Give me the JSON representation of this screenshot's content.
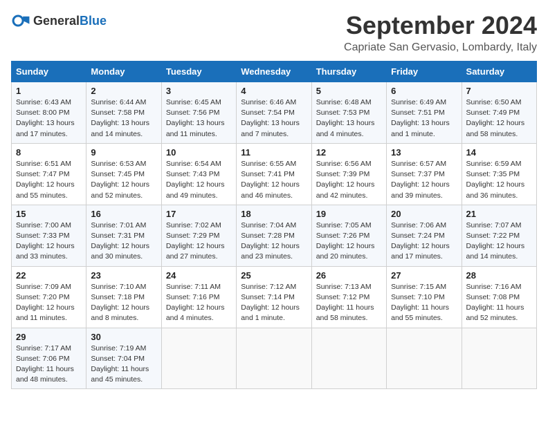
{
  "header": {
    "logo_general": "General",
    "logo_blue": "Blue",
    "month_title": "September 2024",
    "location": "Capriate San Gervasio, Lombardy, Italy"
  },
  "columns": [
    "Sunday",
    "Monday",
    "Tuesday",
    "Wednesday",
    "Thursday",
    "Friday",
    "Saturday"
  ],
  "weeks": [
    [
      {
        "day": "1",
        "lines": [
          "Sunrise: 6:43 AM",
          "Sunset: 8:00 PM",
          "Daylight: 13 hours",
          "and 17 minutes."
        ]
      },
      {
        "day": "2",
        "lines": [
          "Sunrise: 6:44 AM",
          "Sunset: 7:58 PM",
          "Daylight: 13 hours",
          "and 14 minutes."
        ]
      },
      {
        "day": "3",
        "lines": [
          "Sunrise: 6:45 AM",
          "Sunset: 7:56 PM",
          "Daylight: 13 hours",
          "and 11 minutes."
        ]
      },
      {
        "day": "4",
        "lines": [
          "Sunrise: 6:46 AM",
          "Sunset: 7:54 PM",
          "Daylight: 13 hours",
          "and 7 minutes."
        ]
      },
      {
        "day": "5",
        "lines": [
          "Sunrise: 6:48 AM",
          "Sunset: 7:53 PM",
          "Daylight: 13 hours",
          "and 4 minutes."
        ]
      },
      {
        "day": "6",
        "lines": [
          "Sunrise: 6:49 AM",
          "Sunset: 7:51 PM",
          "Daylight: 13 hours",
          "and 1 minute."
        ]
      },
      {
        "day": "7",
        "lines": [
          "Sunrise: 6:50 AM",
          "Sunset: 7:49 PM",
          "Daylight: 12 hours",
          "and 58 minutes."
        ]
      }
    ],
    [
      {
        "day": "8",
        "lines": [
          "Sunrise: 6:51 AM",
          "Sunset: 7:47 PM",
          "Daylight: 12 hours",
          "and 55 minutes."
        ]
      },
      {
        "day": "9",
        "lines": [
          "Sunrise: 6:53 AM",
          "Sunset: 7:45 PM",
          "Daylight: 12 hours",
          "and 52 minutes."
        ]
      },
      {
        "day": "10",
        "lines": [
          "Sunrise: 6:54 AM",
          "Sunset: 7:43 PM",
          "Daylight: 12 hours",
          "and 49 minutes."
        ]
      },
      {
        "day": "11",
        "lines": [
          "Sunrise: 6:55 AM",
          "Sunset: 7:41 PM",
          "Daylight: 12 hours",
          "and 46 minutes."
        ]
      },
      {
        "day": "12",
        "lines": [
          "Sunrise: 6:56 AM",
          "Sunset: 7:39 PM",
          "Daylight: 12 hours",
          "and 42 minutes."
        ]
      },
      {
        "day": "13",
        "lines": [
          "Sunrise: 6:57 AM",
          "Sunset: 7:37 PM",
          "Daylight: 12 hours",
          "and 39 minutes."
        ]
      },
      {
        "day": "14",
        "lines": [
          "Sunrise: 6:59 AM",
          "Sunset: 7:35 PM",
          "Daylight: 12 hours",
          "and 36 minutes."
        ]
      }
    ],
    [
      {
        "day": "15",
        "lines": [
          "Sunrise: 7:00 AM",
          "Sunset: 7:33 PM",
          "Daylight: 12 hours",
          "and 33 minutes."
        ]
      },
      {
        "day": "16",
        "lines": [
          "Sunrise: 7:01 AM",
          "Sunset: 7:31 PM",
          "Daylight: 12 hours",
          "and 30 minutes."
        ]
      },
      {
        "day": "17",
        "lines": [
          "Sunrise: 7:02 AM",
          "Sunset: 7:29 PM",
          "Daylight: 12 hours",
          "and 27 minutes."
        ]
      },
      {
        "day": "18",
        "lines": [
          "Sunrise: 7:04 AM",
          "Sunset: 7:28 PM",
          "Daylight: 12 hours",
          "and 23 minutes."
        ]
      },
      {
        "day": "19",
        "lines": [
          "Sunrise: 7:05 AM",
          "Sunset: 7:26 PM",
          "Daylight: 12 hours",
          "and 20 minutes."
        ]
      },
      {
        "day": "20",
        "lines": [
          "Sunrise: 7:06 AM",
          "Sunset: 7:24 PM",
          "Daylight: 12 hours",
          "and 17 minutes."
        ]
      },
      {
        "day": "21",
        "lines": [
          "Sunrise: 7:07 AM",
          "Sunset: 7:22 PM",
          "Daylight: 12 hours",
          "and 14 minutes."
        ]
      }
    ],
    [
      {
        "day": "22",
        "lines": [
          "Sunrise: 7:09 AM",
          "Sunset: 7:20 PM",
          "Daylight: 12 hours",
          "and 11 minutes."
        ]
      },
      {
        "day": "23",
        "lines": [
          "Sunrise: 7:10 AM",
          "Sunset: 7:18 PM",
          "Daylight: 12 hours",
          "and 8 minutes."
        ]
      },
      {
        "day": "24",
        "lines": [
          "Sunrise: 7:11 AM",
          "Sunset: 7:16 PM",
          "Daylight: 12 hours",
          "and 4 minutes."
        ]
      },
      {
        "day": "25",
        "lines": [
          "Sunrise: 7:12 AM",
          "Sunset: 7:14 PM",
          "Daylight: 12 hours",
          "and 1 minute."
        ]
      },
      {
        "day": "26",
        "lines": [
          "Sunrise: 7:13 AM",
          "Sunset: 7:12 PM",
          "Daylight: 11 hours",
          "and 58 minutes."
        ]
      },
      {
        "day": "27",
        "lines": [
          "Sunrise: 7:15 AM",
          "Sunset: 7:10 PM",
          "Daylight: 11 hours",
          "and 55 minutes."
        ]
      },
      {
        "day": "28",
        "lines": [
          "Sunrise: 7:16 AM",
          "Sunset: 7:08 PM",
          "Daylight: 11 hours",
          "and 52 minutes."
        ]
      }
    ],
    [
      {
        "day": "29",
        "lines": [
          "Sunrise: 7:17 AM",
          "Sunset: 7:06 PM",
          "Daylight: 11 hours",
          "and 48 minutes."
        ]
      },
      {
        "day": "30",
        "lines": [
          "Sunrise: 7:19 AM",
          "Sunset: 7:04 PM",
          "Daylight: 11 hours",
          "and 45 minutes."
        ]
      },
      {
        "day": "",
        "lines": []
      },
      {
        "day": "",
        "lines": []
      },
      {
        "day": "",
        "lines": []
      },
      {
        "day": "",
        "lines": []
      },
      {
        "day": "",
        "lines": []
      }
    ]
  ]
}
